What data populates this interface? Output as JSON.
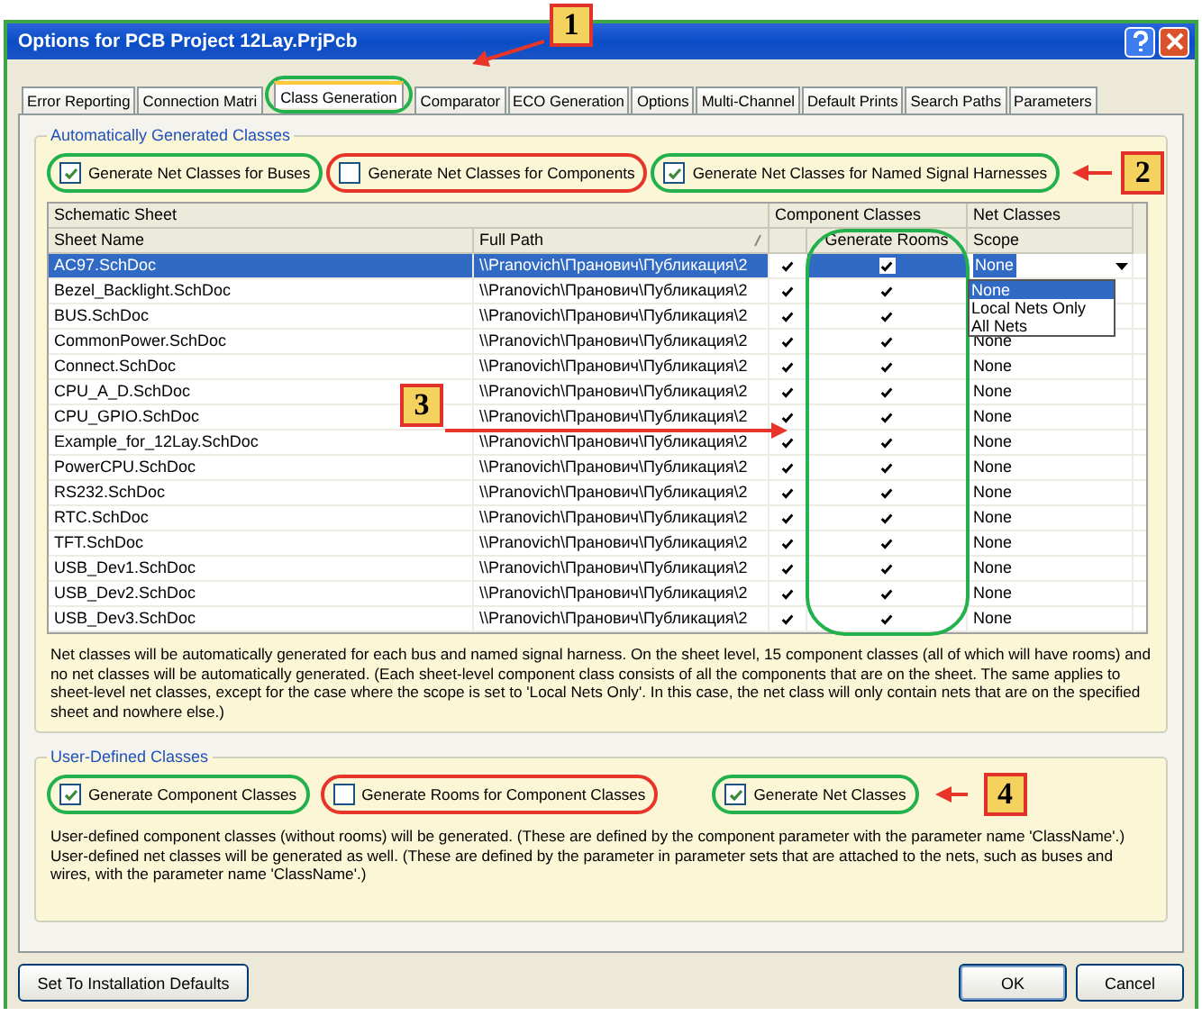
{
  "window": {
    "title": "Options for PCB Project 12Lay.PrjPcb"
  },
  "tabs": [
    {
      "label": "Error Reporting",
      "selected": false
    },
    {
      "label": "Connection Matri",
      "selected": false
    },
    {
      "label": "Class Generation",
      "selected": true
    },
    {
      "label": "Comparator",
      "selected": false
    },
    {
      "label": "ECO Generation",
      "selected": false
    },
    {
      "label": "Options",
      "selected": false
    },
    {
      "label": "Multi-Channel",
      "selected": false
    },
    {
      "label": "Default Prints",
      "selected": false
    },
    {
      "label": "Search Paths",
      "selected": false
    },
    {
      "label": "Parameters",
      "selected": false
    }
  ],
  "auto_group": {
    "title": "Automatically Generated Classes",
    "options": [
      {
        "label": "Generate Net Classes for Buses",
        "checked": true
      },
      {
        "label": "Generate Net Classes for Components",
        "checked": false
      },
      {
        "label": "Generate Net Classes for Named Signal Harnesses",
        "checked": true
      }
    ],
    "table": {
      "group_headers": [
        "Schematic Sheet",
        "Component Classes",
        "Net Classes"
      ],
      "columns": [
        "Sheet Name",
        "Full Path",
        "Generate Rooms",
        "Scope"
      ],
      "rows": [
        {
          "sheet": "AC97.SchDoc",
          "path": "\\\\Pranovich\\Пранович\\Публикация\\2",
          "component": true,
          "rooms": true,
          "scope": "None",
          "selected": true
        },
        {
          "sheet": "Bezel_Backlight.SchDoc",
          "path": "\\\\Pranovich\\Пранович\\Публикация\\2",
          "component": true,
          "rooms": true,
          "selected": false
        },
        {
          "sheet": "BUS.SchDoc",
          "path": "\\\\Pranovich\\Пранович\\Публикация\\2",
          "component": true,
          "rooms": true,
          "selected": false
        },
        {
          "sheet": "CommonPower.SchDoc",
          "path": "\\\\Pranovich\\Пранович\\Публикация\\2",
          "component": true,
          "rooms": true,
          "scope": "None",
          "selected": false
        },
        {
          "sheet": "Connect.SchDoc",
          "path": "\\\\Pranovich\\Пранович\\Публикация\\2",
          "component": true,
          "rooms": true,
          "scope": "None",
          "selected": false
        },
        {
          "sheet": "CPU_A_D.SchDoc",
          "path": "\\\\Pranovich\\Пранович\\Публикация\\2",
          "component": true,
          "rooms": true,
          "scope": "None",
          "selected": false
        },
        {
          "sheet": "CPU_GPIO.SchDoc",
          "path": "\\\\Pranovich\\Пранович\\Публикация\\2",
          "component": true,
          "rooms": true,
          "scope": "None",
          "selected": false
        },
        {
          "sheet": "Example_for_12Lay.SchDoc",
          "path": "\\\\Pranovich\\Пранович\\Публикация\\2",
          "component": true,
          "rooms": true,
          "scope": "None",
          "selected": false
        },
        {
          "sheet": "PowerCPU.SchDoc",
          "path": "\\\\Pranovich\\Пранович\\Публикация\\2",
          "component": true,
          "rooms": true,
          "scope": "None",
          "selected": false
        },
        {
          "sheet": "RS232.SchDoc",
          "path": "\\\\Pranovich\\Пранович\\Публикация\\2",
          "component": true,
          "rooms": true,
          "scope": "None",
          "selected": false
        },
        {
          "sheet": "RTC.SchDoc",
          "path": "\\\\Pranovich\\Пранович\\Публикация\\2",
          "component": true,
          "rooms": true,
          "scope": "None",
          "selected": false
        },
        {
          "sheet": "TFT.SchDoc",
          "path": "\\\\Pranovich\\Пранович\\Публикация\\2",
          "component": true,
          "rooms": true,
          "scope": "None",
          "selected": false
        },
        {
          "sheet": "USB_Dev1.SchDoc",
          "path": "\\\\Pranovich\\Пранович\\Публикация\\2",
          "component": true,
          "rooms": true,
          "scope": "None",
          "selected": false
        },
        {
          "sheet": "USB_Dev2.SchDoc",
          "path": "\\\\Pranovich\\Пранович\\Публикация\\2",
          "component": true,
          "rooms": true,
          "scope": "None",
          "selected": false
        },
        {
          "sheet": "USB_Dev3.SchDoc",
          "path": "\\\\Pranovich\\Пранович\\Публикация\\2",
          "component": true,
          "rooms": true,
          "scope": "None",
          "selected": false
        }
      ]
    },
    "scope_dropdown": {
      "options": [
        {
          "label": "None",
          "selected": true
        },
        {
          "label": "Local Nets Only",
          "selected": false
        },
        {
          "label": "All Nets",
          "selected": false
        }
      ]
    },
    "description": "Net classes will be automatically generated for each bus and named signal harness. On the sheet level, 15 component classes (all of which will have rooms) and no net classes will be automatically generated. (Each sheet-level component class consists of all the components that are on the sheet. The same applies to sheet-level net classes, except for the case where the scope is set to 'Local Nets Only'. In this case, the net class will only contain nets that are on the specified sheet and nowhere else.)"
  },
  "user_group": {
    "title": "User-Defined Classes",
    "options": [
      {
        "label": "Generate Component Classes",
        "checked": true
      },
      {
        "label": "Generate Rooms for Component Classes",
        "checked": false
      },
      {
        "label": "Generate Net Classes",
        "checked": true
      }
    ],
    "description": "User-defined component classes (without rooms) will be generated. (These are defined by the component parameter with the parameter name 'ClassName'.) User-defined net classes will be generated as well. (These are defined by the parameter in parameter sets that are attached to the nets, such as buses and wires, with the parameter name 'ClassName'.)"
  },
  "buttons": [
    "Set To Installation Defaults",
    "OK",
    "Cancel"
  ],
  "callouts": [
    "1",
    "2",
    "3",
    "4"
  ]
}
